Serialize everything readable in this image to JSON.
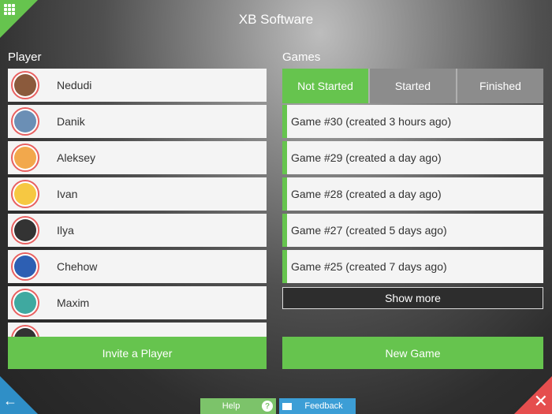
{
  "app": {
    "title": "XB Software"
  },
  "players": {
    "label": "Player",
    "items": [
      {
        "name": "Nedudi",
        "avatar_color": "#8b5a3c"
      },
      {
        "name": "Danik",
        "avatar_color": "#6b8fb5"
      },
      {
        "name": "Aleksey",
        "avatar_color": "#f2a84c"
      },
      {
        "name": "Ivan",
        "avatar_color": "#f6c842"
      },
      {
        "name": "Ilya",
        "avatar_color": "#333333"
      },
      {
        "name": "Chehow",
        "avatar_color": "#2d5fb3"
      },
      {
        "name": "Maxim",
        "avatar_color": "#3fa9a0"
      },
      {
        "name": "",
        "avatar_color": "#333333"
      }
    ],
    "invite_label": "Invite a Player"
  },
  "games": {
    "label": "Games",
    "tabs": [
      {
        "label": "Not Started",
        "active": true
      },
      {
        "label": "Started",
        "active": false
      },
      {
        "label": "Finished",
        "active": false
      }
    ],
    "items": [
      {
        "label": "Game #30 (created 3 hours ago)"
      },
      {
        "label": "Game #29 (created a day ago)"
      },
      {
        "label": "Game #28 (created a day ago)"
      },
      {
        "label": "Game #27 (created 5 days ago)"
      },
      {
        "label": "Game #25 (created 7 days ago)"
      }
    ],
    "show_more_label": "Show more",
    "new_game_label": "New Game"
  },
  "footer": {
    "help_label": "Help",
    "help_icon": "?",
    "feedback_label": "Feedback"
  },
  "colors": {
    "accent": "#66c44e",
    "blue": "#2f8fc7",
    "red": "#e54e4e"
  }
}
